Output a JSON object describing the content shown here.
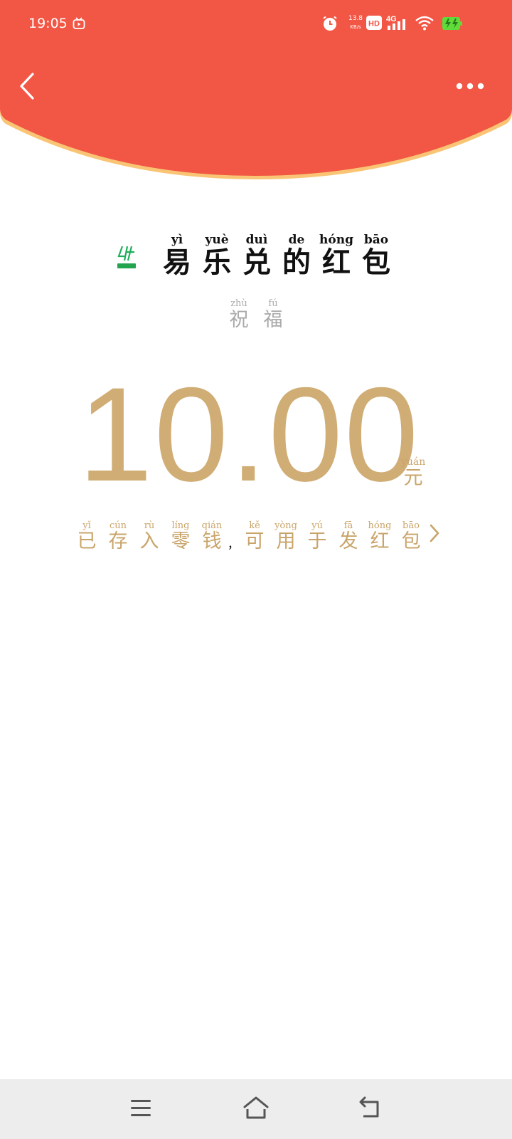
{
  "colors": {
    "header_red": "#f25645",
    "header_edge": "#f9c575",
    "gold": "#d0ad75"
  },
  "status_bar": {
    "time": "19:05",
    "net_speed_value": "13.8",
    "net_speed_unit": "KB/s",
    "hd": "HD",
    "network": "4G"
  },
  "sender": {
    "chars": [
      {
        "py": "yì",
        "hz": "易"
      },
      {
        "py": "yuè",
        "hz": "乐"
      },
      {
        "py": "duì",
        "hz": "兑"
      },
      {
        "py": "de",
        "hz": "的"
      },
      {
        "py": "hóng",
        "hz": "红"
      },
      {
        "py": "bāo",
        "hz": "包"
      }
    ]
  },
  "blessing": {
    "chars": [
      {
        "py": "zhù",
        "hz": "祝"
      },
      {
        "py": "fú",
        "hz": "福"
      }
    ]
  },
  "amount": {
    "value": "10.00",
    "unit_py": "yuán",
    "unit_hz": "元"
  },
  "saved_note": {
    "chars1": [
      {
        "py": "yǐ",
        "hz": "已"
      },
      {
        "py": "cún",
        "hz": "存"
      },
      {
        "py": "rù",
        "hz": "入"
      },
      {
        "py": "líng",
        "hz": "零"
      },
      {
        "py": "qián",
        "hz": "钱"
      }
    ],
    "punct": "，",
    "chars2": [
      {
        "py": "kě",
        "hz": "可"
      },
      {
        "py": "yòng",
        "hz": "用"
      },
      {
        "py": "yú",
        "hz": "于"
      },
      {
        "py": "fā",
        "hz": "发"
      },
      {
        "py": "hóng",
        "hz": "红"
      },
      {
        "py": "bāo",
        "hz": "包"
      }
    ]
  },
  "icons": {
    "back": "chevron-left-icon",
    "more": "more-dots-icon",
    "nav_menu": "menu-icon",
    "nav_home": "home-icon",
    "nav_back": "back-icon"
  }
}
